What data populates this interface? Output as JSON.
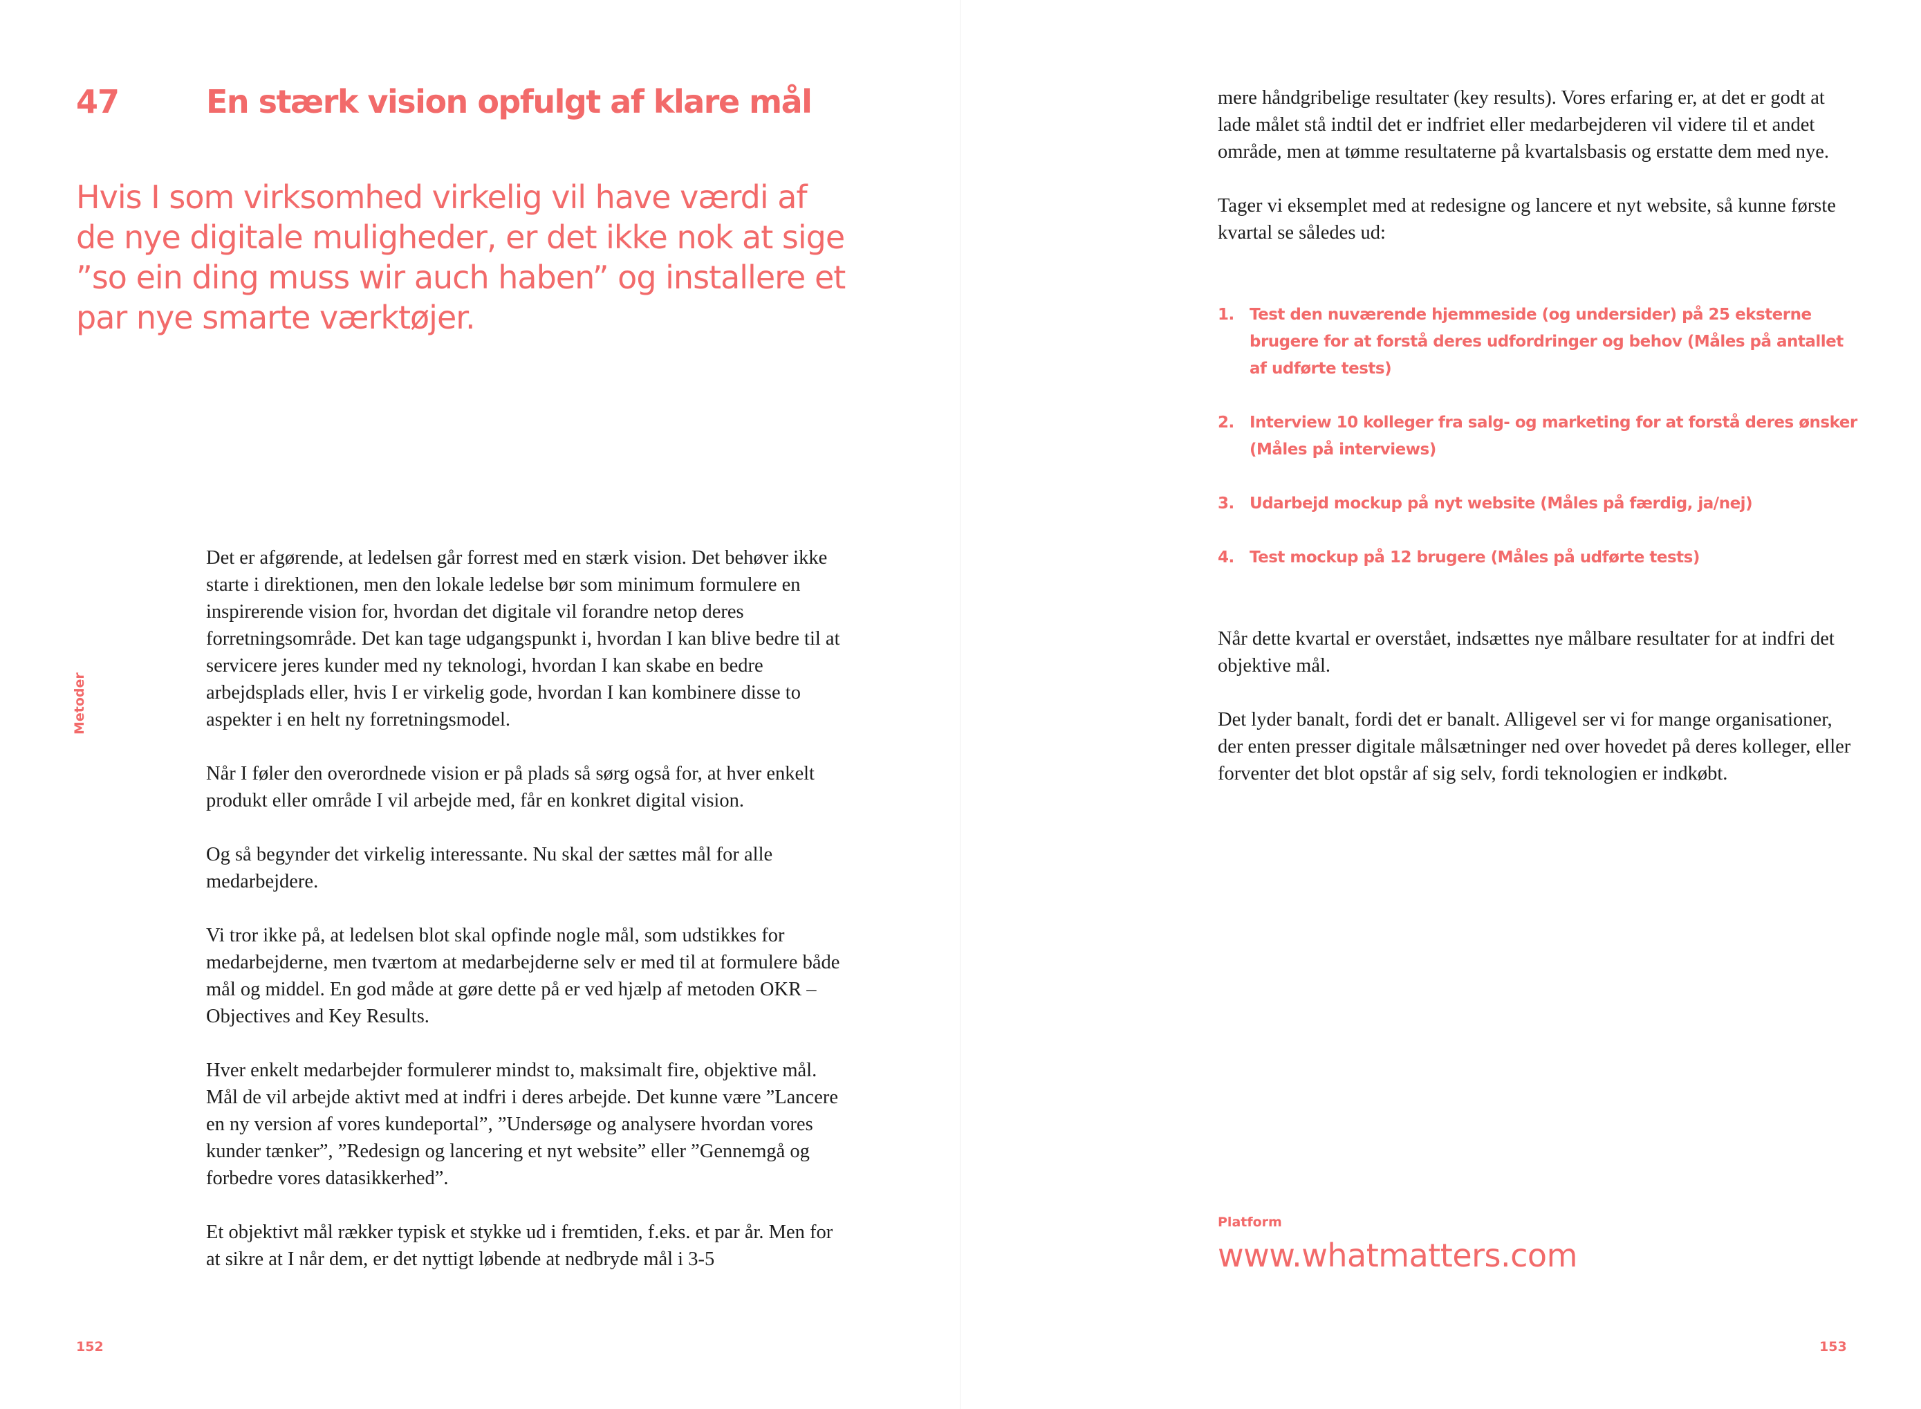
{
  "left_page": {
    "chapter_number": "47",
    "chapter_title": "En stærk vision opfulgt af klare mål",
    "lead": "Hvis I som virksomhed virkelig vil have værdi af de nye digitale muligheder, er det ikke nok at sige ”so ein ding muss wir auch haben” og installere et par nye smarte værktøjer.",
    "side_label": "Metoder",
    "paragraphs": [
      "Det er afgørende, at ledelsen går forrest med en stærk vision. Det behøver ikke starte i direktionen, men den lokale ledelse bør som minimum for­mulere en inspirerende vision for, hvordan det digitale vil forandre netop deres forretningsområde. Det kan tage udgangspunkt i, hvordan I kan blive bedre til at servicere jeres kunder med ny teknologi, hvordan I kan skabe en bedre arbejdsplads eller, hvis I er virkelig gode, hvordan I kan kombinere disse to aspekter i en helt ny forretningsmodel.",
      "Når I føler den overordnede vision er på plads så sørg også for, at hver enkelt produkt eller område I vil arbejde med, får en konkret digital vision.",
      "Og så begynder det virkelig interessante. Nu skal der sættes mål for alle medarbejdere.",
      "Vi tror ikke på, at ledelsen blot skal opfinde nogle mål, som udstikkes for medarbejderne, men tværtom at medarbejderne selv er med til at for­mulere både mål og middel. En god måde at gøre dette på er ved hjælp af metoden OKR – Objectives and Key Results.",
      "Hver enkelt medarbejder formulerer mindst to, maksimalt fire, objektive mål. Mål de vil arbejde aktivt med at indfri i deres arbejde. Det kunne være ”Lancere en ny version af vores kundeportal”, ”Undersøge og analysere hvordan vores kunder tænker”, ”Redesign og lancering et nyt website” eller ”Gennemgå og forbedre vores datasikkerhed”.",
      "Et objektivt mål rækker typisk et stykke ud i fremtiden, f.eks. et par år. Men for at sikre at I når dem, er det nyttigt løbende at nedbryde mål i 3-5"
    ],
    "page_number": "152"
  },
  "right_page": {
    "paragraphs_top": [
      "mere håndgribelige resultater (key results). Vores erfaring er, at det er godt at lade målet stå indtil det er indfriet eller medarbejderen vil videre til et andet område, men at tømme resultaterne på kvartalsbasis og erstatte dem med nye.",
      "Tager vi eksemplet med at redesigne og lancere et nyt website, så kunne første kvartal se således ud:"
    ],
    "list": [
      {
        "number": "1.",
        "text": "Test den nuværende hjemmeside (og undersider) på 25 eksterne brugere for at forstå deres udfordringer og behov (Måles på antallet af udførte tests)"
      },
      {
        "number": "2.",
        "text": "Interview 10 kolleger fra salg- og marketing for at forstå deres ønsker (Måles på interviews)"
      },
      {
        "number": "3.",
        "text": "Udarbejd mockup på nyt website (Måles på færdig, ja/nej)"
      },
      {
        "number": "4.",
        "text": "Test mockup på 12 brugere (Måles på udførte tests)"
      }
    ],
    "paragraphs_bottom": [
      "Når dette kvartal er overstået, indsættes nye målbare resultater for at indfri det objektive mål.",
      "Det lyder banalt, fordi det er banalt. Alligevel ser vi for mange organisati­oner, der enten presser digitale målsætninger ned over hovedet på deres kolleger, eller forventer det blot opstår af sig selv, fordi teknologien er indkøbt."
    ],
    "platform_label": "Platform",
    "platform_url": "www.whatmatters.com",
    "page_number": "153"
  },
  "colors": {
    "accent": "#f26a6a",
    "body_text": "#1e1e1e",
    "background": "#ffffff"
  }
}
